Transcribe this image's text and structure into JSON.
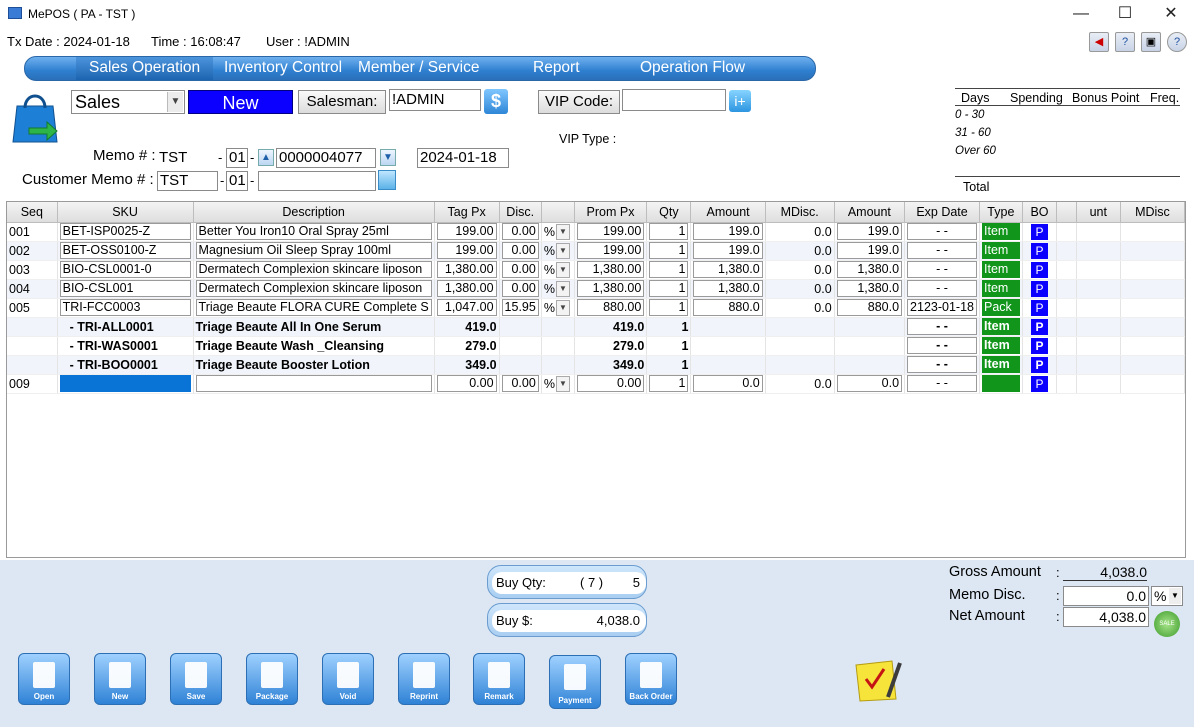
{
  "window": {
    "title": "MePOS ( PA - TST )",
    "minimize": "—",
    "maximize": "☐",
    "close": "✕"
  },
  "info": {
    "tx_date": "Tx Date : 2024-01-18",
    "time": "Time : 16:08:47",
    "user": "User : !ADMIN"
  },
  "top_icons": [
    "exit-icon",
    "help-book-icon",
    "clapper-icon",
    "help-icon"
  ],
  "nav": {
    "items": [
      "Sales Operation",
      "Inventory Control",
      "Member / Service",
      "Report",
      "Operation Flow"
    ],
    "active": "Sales Operation"
  },
  "header": {
    "mode_select": "Sales",
    "new_label": "New",
    "salesman_label": "Salesman:",
    "salesman_value": "!ADMIN",
    "vip_code_label": "VIP Code:",
    "vip_code_value": "",
    "vip_type_label": "VIP Type :",
    "memo_label": "Memo # :",
    "memo_prefix": "TST",
    "memo_dash1": "-",
    "memo_part2": "01",
    "memo_dash2": "-",
    "memo_number": "0000004077",
    "memo_date": "2024-01-18",
    "customer_memo_label": "Customer Memo # :",
    "customer_memo_prefix": "TST",
    "customer_memo_dash1": "-",
    "customer_memo_part2": "01",
    "customer_memo_dash2": "-",
    "customer_memo_number": ""
  },
  "days_panel": {
    "headers": [
      "Days",
      "Spending",
      "Bonus Point",
      "Freq."
    ],
    "rows": [
      "0 - 30",
      "31 - 60",
      "Over 60"
    ],
    "total_label": "Total"
  },
  "grid": {
    "columns": [
      "Seq",
      "SKU",
      "Description",
      "Tag Px",
      "Disc.",
      "",
      "Prom Px",
      "Qty",
      "Amount",
      "MDisc.",
      "Amount",
      "Exp Date",
      "Type",
      "BO",
      "",
      "unt",
      "MDisc"
    ],
    "rows": [
      {
        "seq": "001",
        "sku": "BET-ISP0025-Z",
        "desc": "Better You Iron10 Oral Spray 25ml",
        "tag": "199.00",
        "disc": "0.00",
        "pct": "%",
        "prom": "199.00",
        "qty": "1",
        "amount": "199.0",
        "mdisc": "0.0",
        "amount2": "199.0",
        "exp": "-  -",
        "type": "Item",
        "bo": "P",
        "kind": "main"
      },
      {
        "seq": "002",
        "sku": "BET-OSS0100-Z",
        "desc": "Magnesium Oil Sleep Spray 100ml",
        "tag": "199.00",
        "disc": "0.00",
        "pct": "%",
        "prom": "199.00",
        "qty": "1",
        "amount": "199.0",
        "mdisc": "0.0",
        "amount2": "199.0",
        "exp": "-  -",
        "type": "Item",
        "bo": "P",
        "kind": "main"
      },
      {
        "seq": "003",
        "sku": "BIO-CSL0001-0",
        "desc": "Dermatech Complexion skincare liposon",
        "tag": "1,380.00",
        "disc": "0.00",
        "pct": "%",
        "prom": "1,380.00",
        "qty": "1",
        "amount": "1,380.0",
        "mdisc": "0.0",
        "amount2": "1,380.0",
        "exp": "-  -",
        "type": "Item",
        "bo": "P",
        "kind": "main"
      },
      {
        "seq": "004",
        "sku": "BIO-CSL001",
        "desc": "Dermatech Complexion skincare liposon",
        "tag": "1,380.00",
        "disc": "0.00",
        "pct": "%",
        "prom": "1,380.00",
        "qty": "1",
        "amount": "1,380.0",
        "mdisc": "0.0",
        "amount2": "1,380.0",
        "exp": "-  -",
        "type": "Item",
        "bo": "P",
        "kind": "main"
      },
      {
        "seq": "005",
        "sku": "TRI-FCC0003",
        "desc": "Triage Beaute FLORA CURE Complete S",
        "tag": "1,047.00",
        "disc": "15.95",
        "pct": "%",
        "prom": "880.00",
        "qty": "1",
        "amount": "880.0",
        "mdisc": "0.0",
        "amount2": "880.0",
        "exp": "2123-01-18",
        "type": "Pack",
        "bo": "P",
        "kind": "main"
      },
      {
        "seq": "",
        "sku": "- TRI-ALL0001",
        "desc": "Triage Beaute All In One Serum",
        "tag": "419.0",
        "disc": "",
        "pct": "",
        "prom": "419.0",
        "qty": "1",
        "amount": "",
        "mdisc": "",
        "amount2": "",
        "exp": "-  -",
        "type": "Item",
        "bo": "P",
        "kind": "sub"
      },
      {
        "seq": "",
        "sku": "- TRI-WAS0001",
        "desc": "Triage Beaute Wash _Cleansing",
        "tag": "279.0",
        "disc": "",
        "pct": "",
        "prom": "279.0",
        "qty": "1",
        "amount": "",
        "mdisc": "",
        "amount2": "",
        "exp": "-  -",
        "type": "Item",
        "bo": "P",
        "kind": "sub"
      },
      {
        "seq": "",
        "sku": "- TRI-BOO0001",
        "desc": "Triage Beaute Booster Lotion",
        "tag": "349.0",
        "disc": "",
        "pct": "",
        "prom": "349.0",
        "qty": "1",
        "amount": "",
        "mdisc": "",
        "amount2": "",
        "exp": "-  -",
        "type": "Item",
        "bo": "P",
        "kind": "sub"
      },
      {
        "seq": "009",
        "sku": "",
        "desc": "",
        "tag": "0.00",
        "disc": "0.00",
        "pct": "%",
        "prom": "0.00",
        "qty": "1",
        "amount": "0.0",
        "mdisc": "0.0",
        "amount2": "0.0",
        "exp": "-  -",
        "type": "",
        "bo": "P",
        "kind": "new"
      }
    ]
  },
  "totals": {
    "buy_qty_label": "Buy Qty:",
    "buy_qty_count": "( 7 )",
    "buy_qty_value": "5",
    "buy_amt_label": "Buy $:",
    "buy_amt_value": "4,038.0",
    "gross_label": "Gross Amount",
    "gross_colon": ":",
    "gross_value": "4,038.0",
    "memo_disc_label": "Memo Disc.",
    "memo_disc_colon": ":",
    "memo_disc_value": "0.0",
    "memo_disc_unit": "%",
    "net_label": "Net Amount",
    "net_colon": ":",
    "net_value": "4,038.0"
  },
  "toolbar": [
    "Open",
    "New",
    "Save",
    "Package",
    "Void",
    "Reprint",
    "Remark",
    "Payment",
    "Back Order"
  ],
  "colors": {
    "nav_blue": "#2f7fd0",
    "new_blue": "#0b00ff",
    "type_green": "#11951b",
    "bottom_bg": "#dce7f3"
  }
}
